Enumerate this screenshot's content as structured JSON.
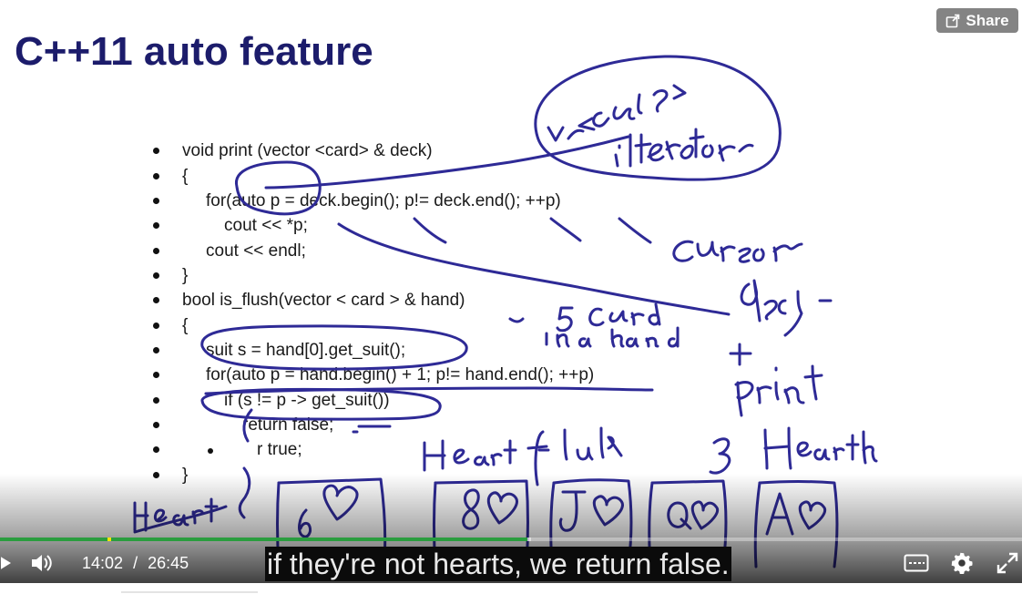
{
  "slide": {
    "title": "C++11 auto feature",
    "code_lines": [
      "void print (vector <card> & deck)",
      "{",
      "for(auto p = deck.begin(); p!= deck.end(); ++p)",
      "cout << *p;",
      "cout << endl;",
      "}",
      "bool is_flush(vector < card > & hand)",
      "{",
      "suit s = hand[0].get_suit();",
      "for(auto p = hand.begin() + 1; p!= hand.end(); ++p)",
      "if (s != p -> get_suit())",
      "return false;",
      "r true;",
      "}"
    ],
    "handwriting": [
      "vr <card>",
      "iterator",
      "cursor",
      "5 card in a hand",
      "deck + print",
      "Heart flush",
      "3 Hearts",
      "heart",
      "6",
      "8",
      "J",
      "Q",
      "A"
    ]
  },
  "share": {
    "label": "Share",
    "icon": "share-icon"
  },
  "player": {
    "current_time": "14:02",
    "separator": "/",
    "duration": "26:45",
    "played_fraction": 0.516,
    "buffered_fraction": 0.52,
    "caption": "if they're not hearts, we return false.",
    "icons": [
      "play-icon",
      "volume-icon",
      "captions-icon",
      "settings-icon",
      "fullscreen-icon"
    ],
    "accent_color": "#2a9d3f"
  }
}
